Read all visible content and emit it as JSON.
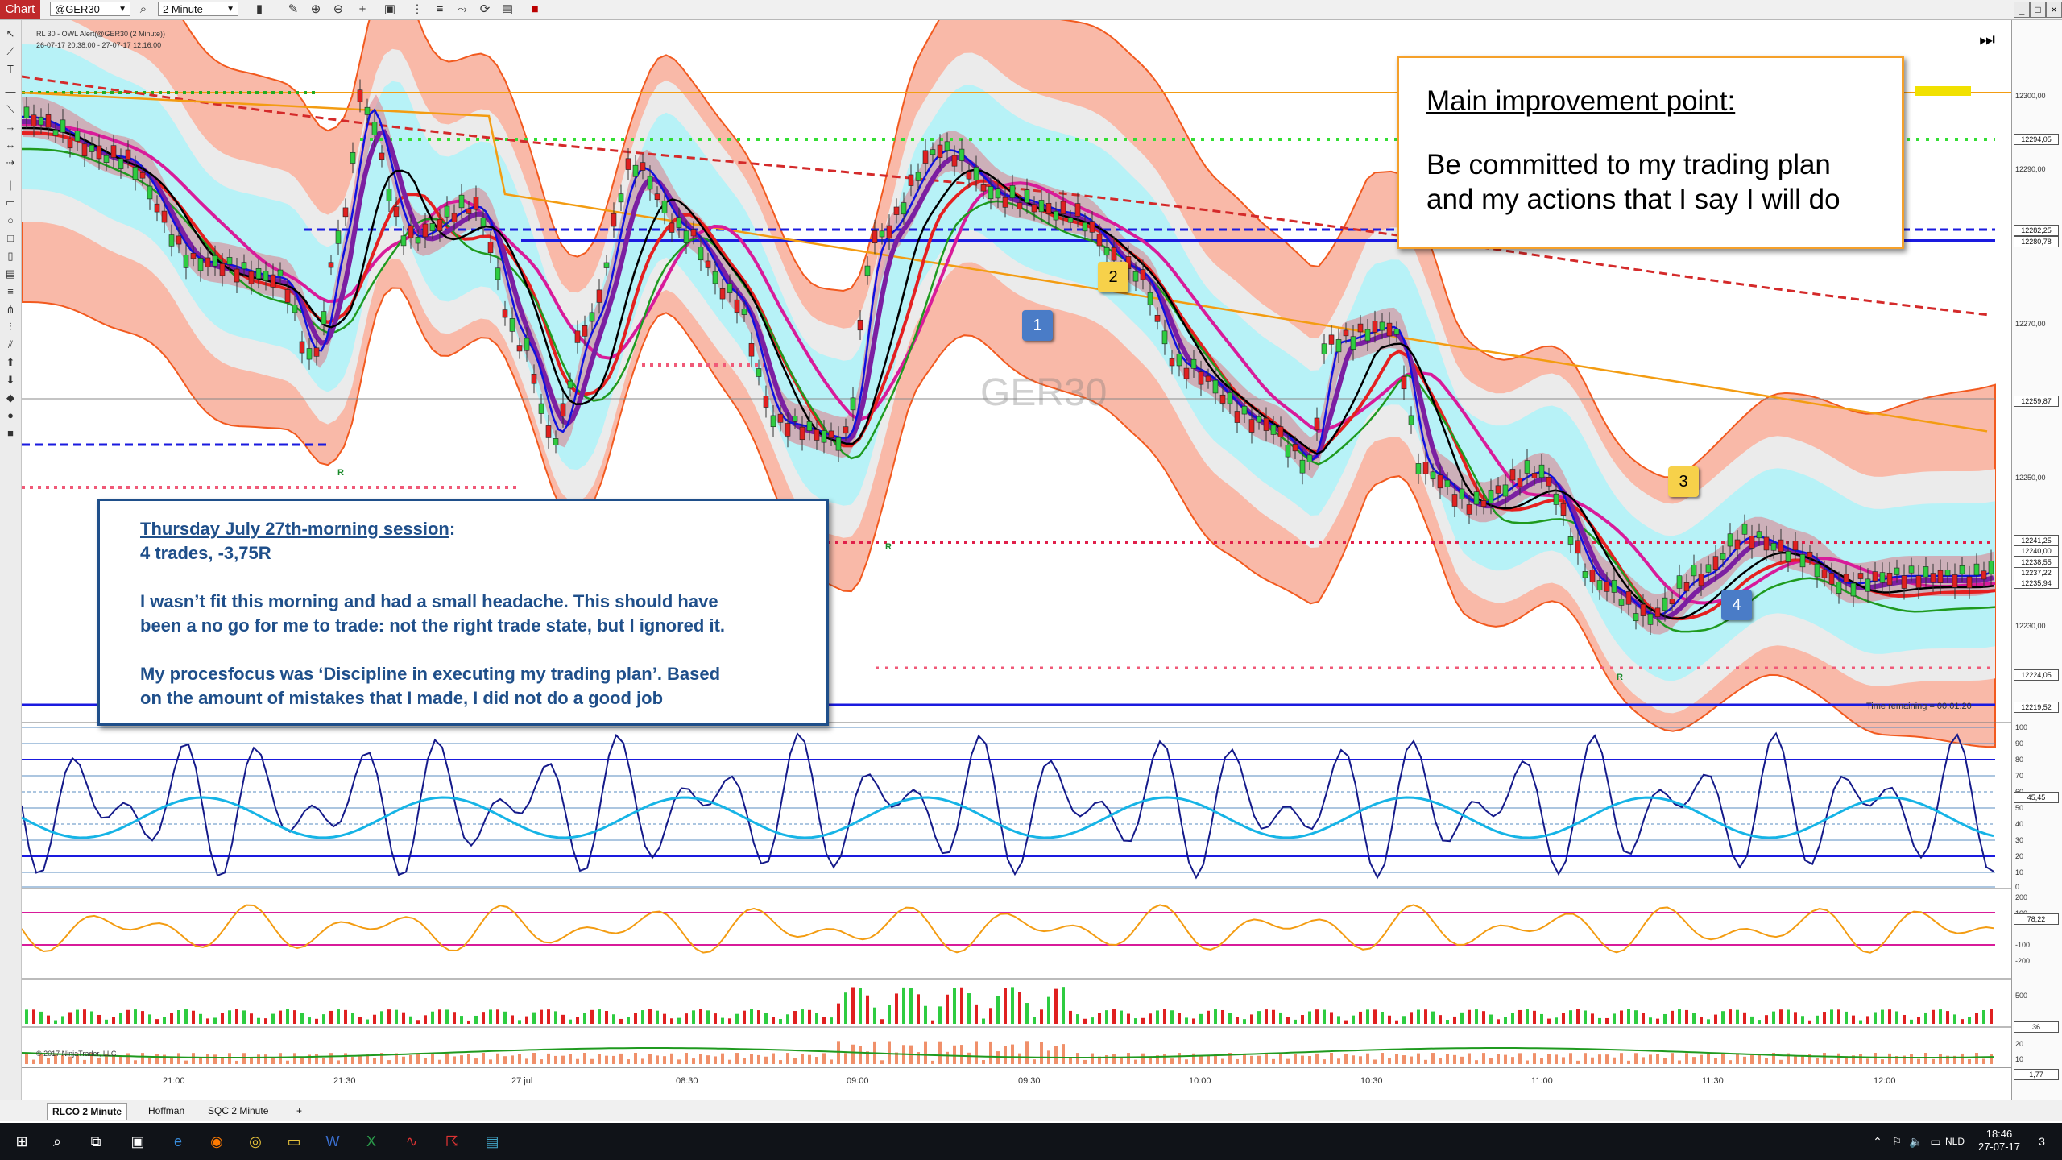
{
  "toolbar": {
    "chart_tab": "Chart",
    "instrument": "@GER30",
    "interval": "2 Minute"
  },
  "chart_info": {
    "title": "RL 30 - OWL Alert(@GER30 (2 Minute))",
    "range": "26-07-17 20:38:00 - 27-07-17 12:16:00",
    "watermark": "GER30",
    "copyright": "© 2017 NinjaTrader, LLC",
    "time_remaining": "Time remaining = 00:01:20"
  },
  "notes": {
    "improvement_title": "Main improvement point:",
    "improvement_line1": "Be committed to my trading plan",
    "improvement_line2": "and my actions that I say I will do",
    "session_title": "Thursday July 27th-morning session",
    "session_colon": ":",
    "session_trades": "4 trades, -3,75R",
    "session_p1_l1": "I wasn’t fit this morning and had a small headache. This should have",
    "session_p1_l2": "been a no go for me to trade: not the right trade state, but I ignored it.",
    "session_p2_l1": "My procesfocus was ‘Discipline in executing my trading plan’. Based",
    "session_p2_l2": "on the amount of mistakes that I made, I did not do a good job"
  },
  "trade_markers": [
    "1",
    "2",
    "3",
    "4"
  ],
  "signal_labels": [
    "R",
    "R",
    "R",
    "R"
  ],
  "price_axis": {
    "labels": [
      "12300,00",
      "12290,00",
      "12270,00",
      "12250,00",
      "12230,00"
    ],
    "boxes": [
      "12294,05",
      "12282,25",
      "12280,78",
      "12259,87",
      "12241,25",
      "12240,00",
      "12238,55",
      "12237,22",
      "12235,94",
      "12224,05",
      "12219,52"
    ]
  },
  "osc_axis": {
    "labels": [
      "100",
      "90",
      "80",
      "70",
      "60",
      "50",
      "40",
      "30",
      "20",
      "10",
      "0"
    ],
    "boxes": [
      "45,45"
    ]
  },
  "cci_axis": {
    "labels": [
      "200",
      "100",
      "-100",
      "-200"
    ],
    "boxes": [
      "78,22"
    ]
  },
  "vol_axis": {
    "labels": [
      "500"
    ],
    "boxes": [
      "36"
    ]
  },
  "adx_axis": {
    "labels": [
      "20",
      "10"
    ],
    "boxes": [
      "1,77"
    ]
  },
  "time_axis": [
    "21:00",
    "21:30",
    "27 jul",
    "08:30",
    "09:00",
    "09:30",
    "10:00",
    "10:30",
    "11:00",
    "11:30",
    "12:00"
  ],
  "tabs": [
    "RLCO  2 Minute",
    "Hoffman",
    "SQC  2 Minute",
    "+"
  ],
  "taskbar": {
    "lang": "NLD",
    "time": "18:46",
    "date": "27-07-17",
    "notification_count": "3"
  },
  "colors": {
    "red_band": "#f9b9a8",
    "cyan_band": "#b7f2f7",
    "grey_band": "#ebebeb",
    "note_border": "#f5a02a",
    "session_border": "#1f4f8a",
    "marker_yellow": "#f7d14a",
    "marker_blue": "#4a7cc7"
  }
}
